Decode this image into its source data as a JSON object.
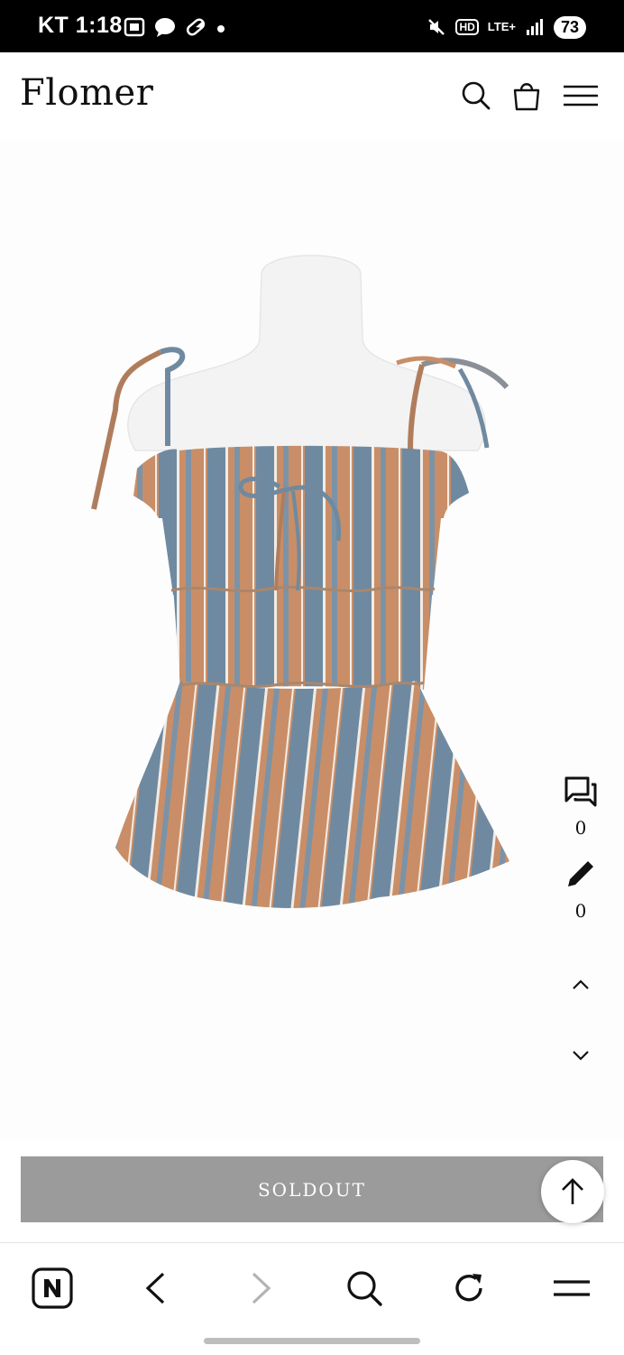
{
  "status_bar": {
    "carrier_time": "KT 1:18",
    "network": "LTE+",
    "hd_badge": "HD",
    "battery": "73",
    "icons_left": [
      "screenshot-icon",
      "chat-bubble-icon",
      "pill-icon",
      "dot-icon"
    ],
    "icons_right": [
      "mute-icon",
      "hd-voice-icon",
      "lte-icon",
      "signal-icon",
      "battery-icon"
    ]
  },
  "header": {
    "brand": "Flomer",
    "icons": [
      "search-icon",
      "cart-bag-icon",
      "hamburger-menu-icon"
    ]
  },
  "product": {
    "image_alt_semantic": "striped-tie-strap-top-product-image",
    "colors": {
      "stripe_orange": "#c98e67",
      "stripe_blue": "#6f8aa0",
      "stripe_white": "#f2ece6",
      "mannequin": "#f3f3f3"
    }
  },
  "side_tools": {
    "qna_count": "0",
    "review_count": "0"
  },
  "buy": {
    "soldout_label": "SOLDOUT"
  },
  "browser_nav": {
    "icons": [
      "naver-n-icon",
      "back-arrow-icon",
      "forward-arrow-icon",
      "search-icon",
      "refresh-icon",
      "menu-icon"
    ]
  },
  "colors": {
    "soldout_bg": "#9b9b9b",
    "statusbar_bg": "#000000",
    "text": "#111111"
  }
}
